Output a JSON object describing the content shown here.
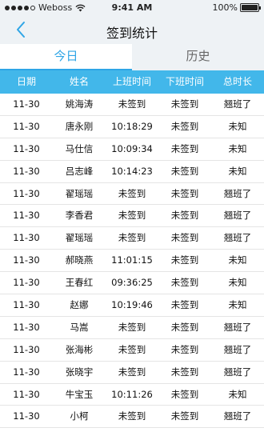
{
  "status_bar": {
    "carrier": "Weboss",
    "time": "9:41 AM",
    "battery": "100%"
  },
  "nav": {
    "title": "签到统计"
  },
  "tabs": [
    {
      "label": "今日"
    },
    {
      "label": "历史"
    }
  ],
  "table": {
    "headers": [
      "日期",
      "姓名",
      "上班时间",
      "下班时间",
      "总时长"
    ],
    "rows": [
      {
        "date": "11-30",
        "name": "姚海涛",
        "on": "未签到",
        "off": "未签到",
        "total": "翘班了"
      },
      {
        "date": "11-30",
        "name": "唐永刚",
        "on": "10:18:29",
        "off": "未签到",
        "total": "未知"
      },
      {
        "date": "11-30",
        "name": "马仕信",
        "on": "10:09:34",
        "off": "未签到",
        "total": "未知"
      },
      {
        "date": "11-30",
        "name": "吕志峰",
        "on": "10:14:23",
        "off": "未签到",
        "total": "未知"
      },
      {
        "date": "11-30",
        "name": "翟瑶瑶",
        "on": "未签到",
        "off": "未签到",
        "total": "翘班了"
      },
      {
        "date": "11-30",
        "name": "李香君",
        "on": "未签到",
        "off": "未签到",
        "total": "翘班了"
      },
      {
        "date": "11-30",
        "name": "翟瑶瑶",
        "on": "未签到",
        "off": "未签到",
        "total": "翘班了"
      },
      {
        "date": "11-30",
        "name": "郝晓燕",
        "on": "11:01:15",
        "off": "未签到",
        "total": "未知"
      },
      {
        "date": "11-30",
        "name": "王春红",
        "on": "09:36:25",
        "off": "未签到",
        "total": "未知"
      },
      {
        "date": "11-30",
        "name": "赵娜",
        "on": "10:19:46",
        "off": "未签到",
        "total": "未知"
      },
      {
        "date": "11-30",
        "name": "马嵩",
        "on": "未签到",
        "off": "未签到",
        "total": "翘班了"
      },
      {
        "date": "11-30",
        "name": "张海彬",
        "on": "未签到",
        "off": "未签到",
        "total": "翘班了"
      },
      {
        "date": "11-30",
        "name": "张晓宇",
        "on": "未签到",
        "off": "未签到",
        "total": "翘班了"
      },
      {
        "date": "11-30",
        "name": "牛宝玉",
        "on": "10:11:26",
        "off": "未签到",
        "total": "未知"
      },
      {
        "date": "11-30",
        "name": "小柯",
        "on": "未签到",
        "off": "未签到",
        "total": "翘班了"
      }
    ]
  }
}
